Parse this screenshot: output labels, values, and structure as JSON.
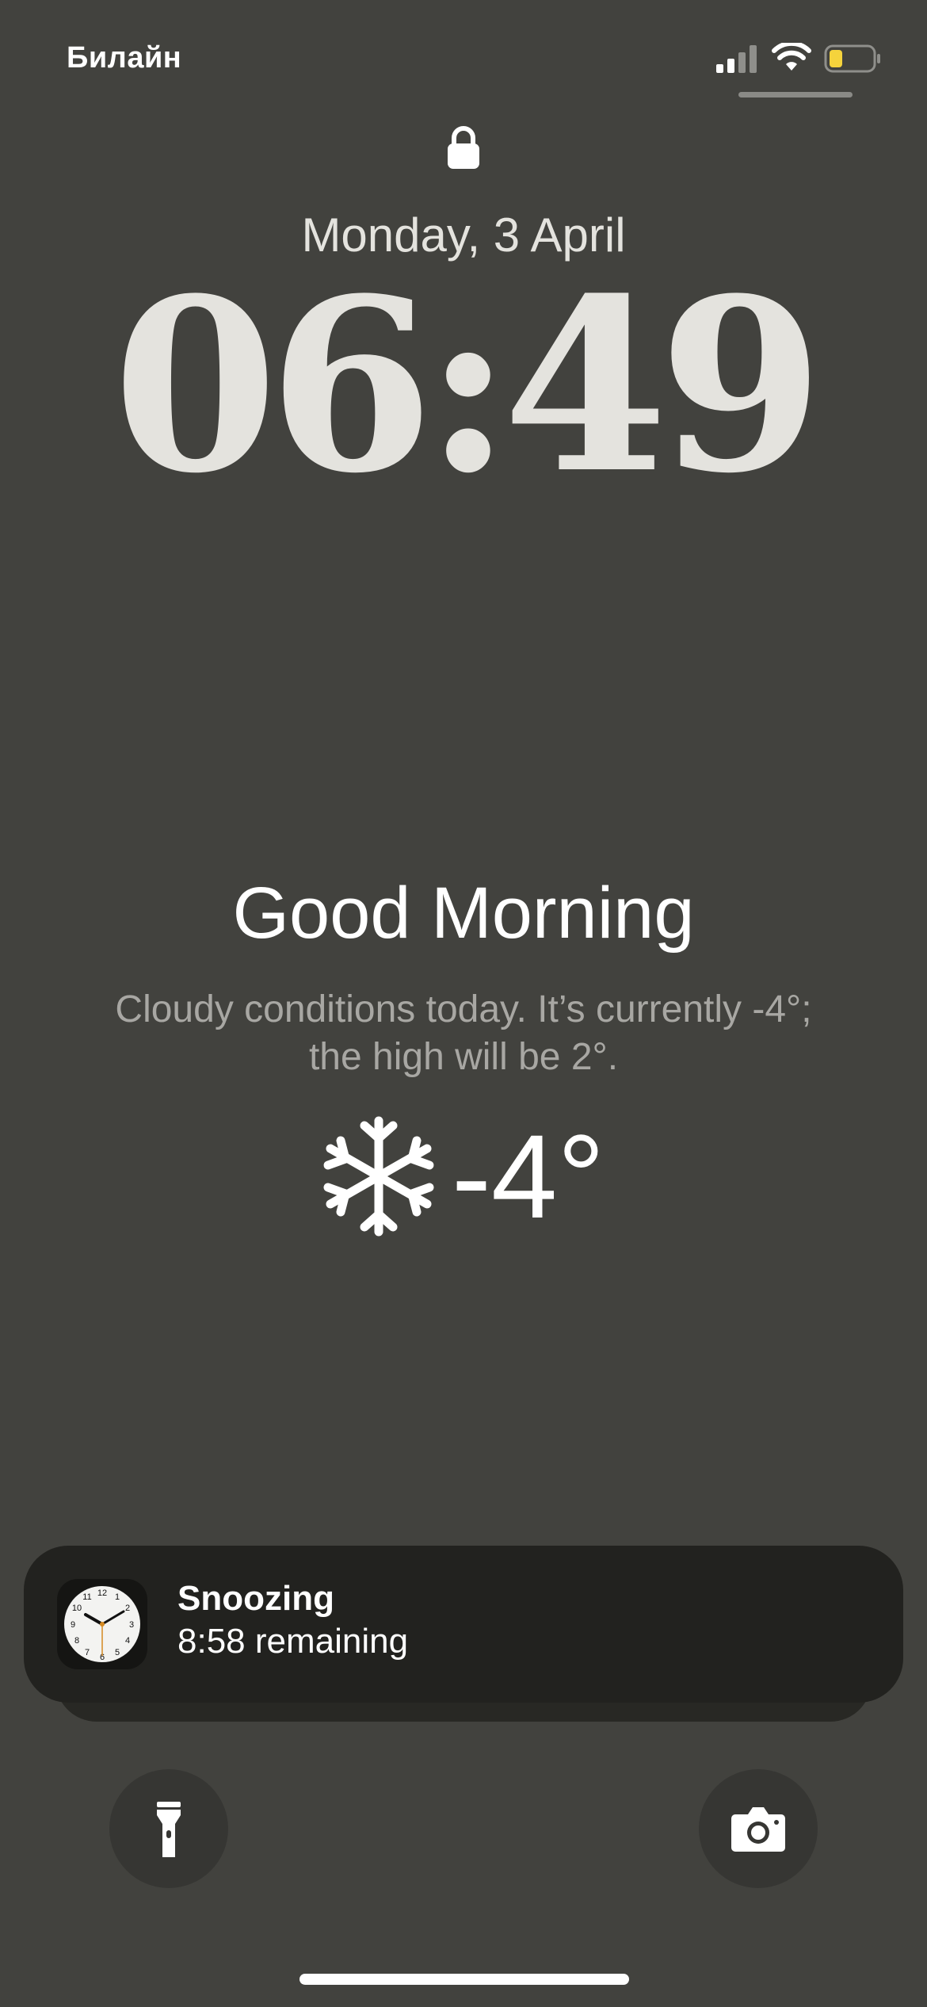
{
  "status_bar": {
    "carrier": "Билайн",
    "signal_icon": "cellular-signal-icon",
    "wifi_icon": "wifi-icon",
    "battery_icon": "battery-icon",
    "battery_level_fraction": 0.25,
    "battery_color": "#f5d33c"
  },
  "lock_screen": {
    "lock_icon": "lock-icon",
    "date": "Monday, 3 April",
    "time": "06:49"
  },
  "weather_widget": {
    "greeting": "Good Morning",
    "forecast": "Cloudy conditions today. It’s currently -4°; the high will be 2°.",
    "condition_icon": "snowflake-icon",
    "temperature": "-4°"
  },
  "notification": {
    "app_icon": "clock-app-icon",
    "title": "Snoozing",
    "body": "8:58 remaining"
  },
  "controls": {
    "left_icon": "flashlight-icon",
    "right_icon": "camera-icon"
  },
  "colors": {
    "background": "#42423e",
    "text_primary": "#ffffff",
    "text_secondary": "#a8a7a3",
    "clock_text": "#e4e3de",
    "notification_bg": "#22221f"
  }
}
